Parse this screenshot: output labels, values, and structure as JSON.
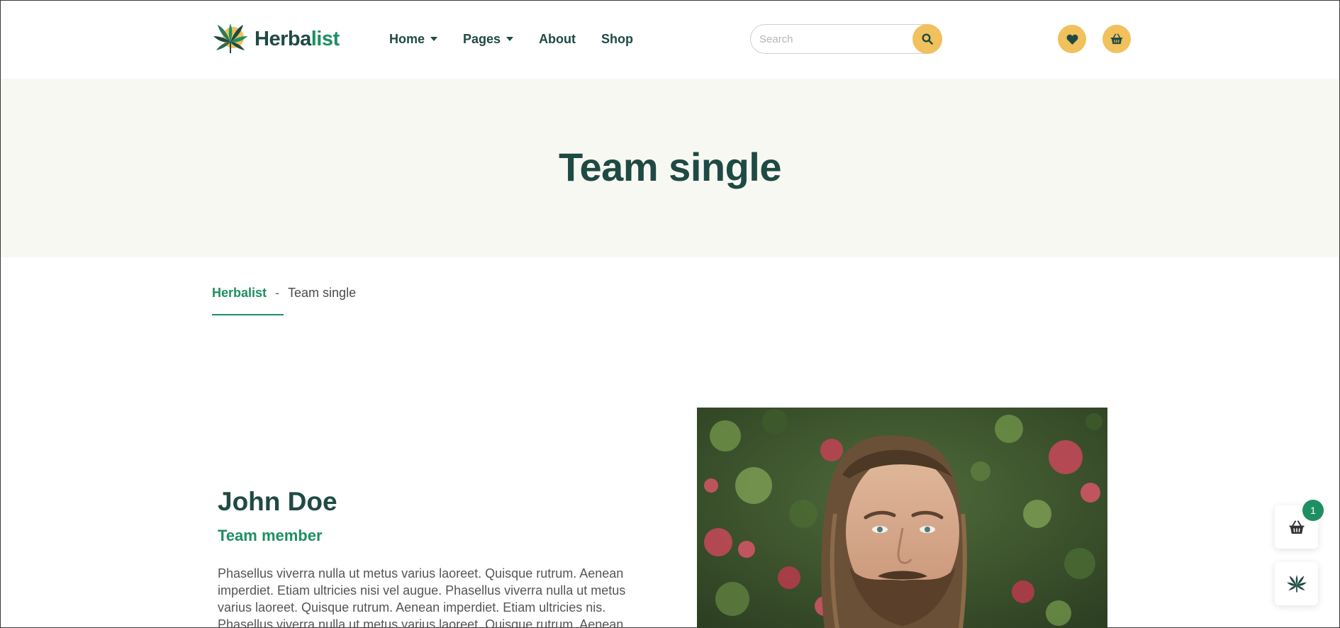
{
  "header": {
    "logo": {
      "text_primary": "Herba",
      "text_accent": "list"
    },
    "nav": [
      {
        "label": "Home",
        "has_dropdown": true
      },
      {
        "label": "Pages",
        "has_dropdown": true
      },
      {
        "label": "About",
        "has_dropdown": false
      },
      {
        "label": "Shop",
        "has_dropdown": false
      }
    ],
    "search": {
      "placeholder": "Search",
      "value": ""
    },
    "icons": {
      "search": "search-icon",
      "wishlist": "heart-icon",
      "cart": "basket-icon"
    }
  },
  "hero": {
    "title": "Team single"
  },
  "breadcrumb": {
    "home": "Herbalist",
    "separator": "-",
    "current": "Team single"
  },
  "member": {
    "name": "John Doe",
    "role": "Team member",
    "bio": "Phasellus viverra nulla ut metus varius laoreet. Quisque rutrum. Aenean imperdiet. Etiam ultricies nisi vel augue. Phasellus viverra nulla ut metus varius laoreet. Quisque rutrum. Aenean imperdiet. Etiam ultricies nis. Phasellus viverra nulla ut metus varius laoreet. Quisque rutrum. Aenean"
  },
  "floating": {
    "cart_count": "1",
    "icons": {
      "cart": "basket-icon",
      "leaf": "leaf-icon"
    }
  },
  "colors": {
    "brand_dark": "#1f4a44",
    "brand_green": "#1e8f62",
    "accent_yellow": "#f0c15c",
    "hero_bg": "#f8f8f3"
  }
}
